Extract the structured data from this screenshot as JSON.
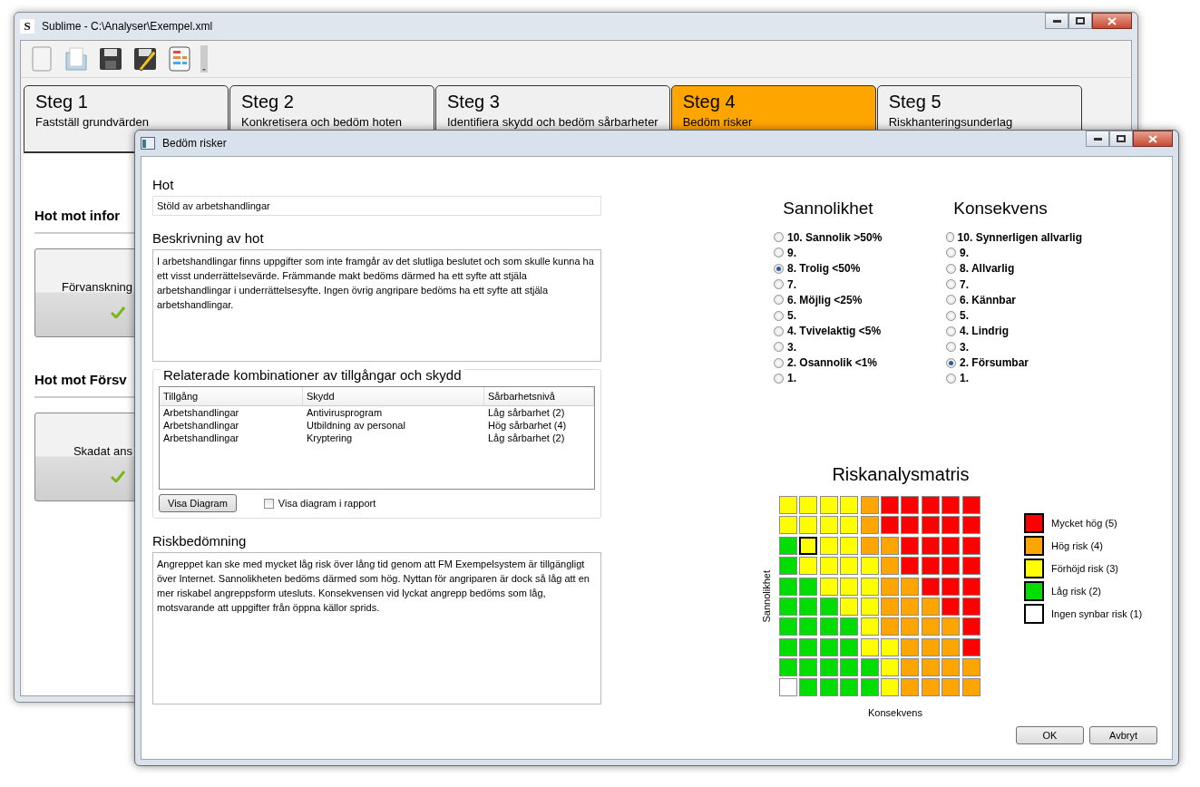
{
  "main_window": {
    "app_icon": "S",
    "title": "Sublime - C:\\Analyser\\Exempel.xml",
    "tabs": [
      {
        "step": "Steg 1",
        "label": "Fastställ grundvärden",
        "selected": false
      },
      {
        "step": "Steg 2",
        "label": "Konkretisera och bedöm hoten",
        "selected": false
      },
      {
        "step": "Steg 3",
        "label": "Identifiera skydd och bedöm sårbarheter",
        "selected": false
      },
      {
        "step": "Steg 4",
        "label": "Bedöm risker",
        "selected": true
      },
      {
        "step": "Steg 5",
        "label": "Riskhanteringsunderlag",
        "selected": false
      }
    ],
    "sections": [
      {
        "heading": "Hot mot infor",
        "cards": [
          {
            "label": "Förvanskning",
            "done": true
          }
        ]
      },
      {
        "heading": "Hot mot Försv",
        "cards": [
          {
            "label": "Skadat ans",
            "done": true
          }
        ]
      }
    ]
  },
  "dialog": {
    "title": "Bedöm risker",
    "threat_label": "Hot",
    "threat": "Stöld av arbetshandlingar",
    "description_label": "Beskrivning av hot",
    "description": "I arbetshandlingar finns uppgifter som inte framgår av det slutliga beslutet och som skulle kunna ha ett visst underrättelsevärde. Främmande makt bedöms därmed ha ett syfte att stjäla arbetshandlingar i underrättelsesyfte. Ingen övrig angripare bedöms ha ett syfte att stjäla arbetshandlingar.",
    "related": {
      "legend": "Relaterade kombinationer av tillgångar och skydd",
      "columns": [
        "Tillgång",
        "Skydd",
        "Sårbarhetsnivå"
      ],
      "rows": [
        [
          "Arbetshandlingar",
          "Antivirusprogram",
          "Låg sårbarhet (2)"
        ],
        [
          "Arbetshandlingar",
          "Utbildning av personal",
          "Hög sårbarhet (4)"
        ],
        [
          "Arbetshandlingar",
          "Kryptering",
          "Låg sårbarhet (2)"
        ]
      ],
      "diagram_button": "Visa Diagram",
      "report_checkbox": {
        "label": "Visa diagram i rapport",
        "checked": false
      }
    },
    "assessment_label": "Riskbedömning",
    "assessment": "Angreppet kan ske med mycket låg risk över lång tid genom att FM Exempelsystem är tillgängligt över Internet. Sannolikheten bedöms därmed som hög. Nyttan för angriparen är dock så låg att en mer riskabel angreppsform utesluts. Konsekvensen vid lyckat angrepp bedöms som låg, motsvarande att uppgifter från öppna källor sprids.",
    "likelihood": {
      "heading": "Sannolikhet",
      "options": [
        {
          "label": "10. Sannolik >50%",
          "selected": false
        },
        {
          "label": "9.",
          "selected": false
        },
        {
          "label": "8. Trolig <50%",
          "selected": true
        },
        {
          "label": "7.",
          "selected": false
        },
        {
          "label": "6. Möjlig <25%",
          "selected": false
        },
        {
          "label": "5.",
          "selected": false
        },
        {
          "label": "4. Tvivelaktig <5%",
          "selected": false
        },
        {
          "label": "3.",
          "selected": false
        },
        {
          "label": "2. Osannolik <1%",
          "selected": false
        },
        {
          "label": "1.",
          "selected": false
        }
      ]
    },
    "consequence": {
      "heading": "Konsekvens",
      "options": [
        {
          "label": "10. Synnerligen allvarlig",
          "selected": false
        },
        {
          "label": "9.",
          "selected": false
        },
        {
          "label": "8. Allvarlig",
          "selected": false
        },
        {
          "label": "7.",
          "selected": false
        },
        {
          "label": "6. Kännbar",
          "selected": false
        },
        {
          "label": "5.",
          "selected": false
        },
        {
          "label": "4. Lindrig",
          "selected": false
        },
        {
          "label": "3.",
          "selected": false
        },
        {
          "label": "2. Försumbar",
          "selected": true
        },
        {
          "label": "1.",
          "selected": false
        }
      ]
    },
    "matrix": {
      "title": "Riskanalysmatris",
      "ylabel": "Sannolikhet",
      "xlabel": "Konsekvens",
      "rows": [
        [
          {
            "color": "#ffff00",
            "selected": false
          },
          {
            "color": "#ffff00",
            "selected": false
          },
          {
            "color": "#ffff00",
            "selected": false
          },
          {
            "color": "#ffff00",
            "selected": false
          },
          {
            "color": "#ffa500",
            "selected": false
          },
          {
            "color": "#ff0000",
            "selected": false
          },
          {
            "color": "#ff0000",
            "selected": false
          },
          {
            "color": "#ff0000",
            "selected": false
          },
          {
            "color": "#ff0000",
            "selected": false
          },
          {
            "color": "#ff0000",
            "selected": false
          }
        ],
        [
          {
            "color": "#ffff00",
            "selected": false
          },
          {
            "color": "#ffff00",
            "selected": false
          },
          {
            "color": "#ffff00",
            "selected": false
          },
          {
            "color": "#ffff00",
            "selected": false
          },
          {
            "color": "#ffa500",
            "selected": false
          },
          {
            "color": "#ff0000",
            "selected": false
          },
          {
            "color": "#ff0000",
            "selected": false
          },
          {
            "color": "#ff0000",
            "selected": false
          },
          {
            "color": "#ff0000",
            "selected": false
          },
          {
            "color": "#ff0000",
            "selected": false
          }
        ],
        [
          {
            "color": "#00dd00",
            "selected": false
          },
          {
            "color": "#ffff00",
            "selected": true
          },
          {
            "color": "#ffff00",
            "selected": false
          },
          {
            "color": "#ffff00",
            "selected": false
          },
          {
            "color": "#ffa500",
            "selected": false
          },
          {
            "color": "#ffa500",
            "selected": false
          },
          {
            "color": "#ff0000",
            "selected": false
          },
          {
            "color": "#ff0000",
            "selected": false
          },
          {
            "color": "#ff0000",
            "selected": false
          },
          {
            "color": "#ff0000",
            "selected": false
          }
        ],
        [
          {
            "color": "#00dd00",
            "selected": false
          },
          {
            "color": "#ffff00",
            "selected": false
          },
          {
            "color": "#ffff00",
            "selected": false
          },
          {
            "color": "#ffff00",
            "selected": false
          },
          {
            "color": "#ffff00",
            "selected": false
          },
          {
            "color": "#ffa500",
            "selected": false
          },
          {
            "color": "#ff0000",
            "selected": false
          },
          {
            "color": "#ff0000",
            "selected": false
          },
          {
            "color": "#ff0000",
            "selected": false
          },
          {
            "color": "#ff0000",
            "selected": false
          }
        ],
        [
          {
            "color": "#00dd00",
            "selected": false
          },
          {
            "color": "#00dd00",
            "selected": false
          },
          {
            "color": "#ffff00",
            "selected": false
          },
          {
            "color": "#ffff00",
            "selected": false
          },
          {
            "color": "#ffff00",
            "selected": false
          },
          {
            "color": "#ffa500",
            "selected": false
          },
          {
            "color": "#ffa500",
            "selected": false
          },
          {
            "color": "#ff0000",
            "selected": false
          },
          {
            "color": "#ff0000",
            "selected": false
          },
          {
            "color": "#ff0000",
            "selected": false
          }
        ],
        [
          {
            "color": "#00dd00",
            "selected": false
          },
          {
            "color": "#00dd00",
            "selected": false
          },
          {
            "color": "#00dd00",
            "selected": false
          },
          {
            "color": "#ffff00",
            "selected": false
          },
          {
            "color": "#ffff00",
            "selected": false
          },
          {
            "color": "#ffa500",
            "selected": false
          },
          {
            "color": "#ffa500",
            "selected": false
          },
          {
            "color": "#ffa500",
            "selected": false
          },
          {
            "color": "#ff0000",
            "selected": false
          },
          {
            "color": "#ff0000",
            "selected": false
          }
        ],
        [
          {
            "color": "#00dd00",
            "selected": false
          },
          {
            "color": "#00dd00",
            "selected": false
          },
          {
            "color": "#00dd00",
            "selected": false
          },
          {
            "color": "#00dd00",
            "selected": false
          },
          {
            "color": "#ffff00",
            "selected": false
          },
          {
            "color": "#ffa500",
            "selected": false
          },
          {
            "color": "#ffa500",
            "selected": false
          },
          {
            "color": "#ffa500",
            "selected": false
          },
          {
            "color": "#ffa500",
            "selected": false
          },
          {
            "color": "#ff0000",
            "selected": false
          }
        ],
        [
          {
            "color": "#00dd00",
            "selected": false
          },
          {
            "color": "#00dd00",
            "selected": false
          },
          {
            "color": "#00dd00",
            "selected": false
          },
          {
            "color": "#00dd00",
            "selected": false
          },
          {
            "color": "#ffff00",
            "selected": false
          },
          {
            "color": "#ffff00",
            "selected": false
          },
          {
            "color": "#ffa500",
            "selected": false
          },
          {
            "color": "#ffa500",
            "selected": false
          },
          {
            "color": "#ffa500",
            "selected": false
          },
          {
            "color": "#ff0000",
            "selected": false
          }
        ],
        [
          {
            "color": "#00dd00",
            "selected": false
          },
          {
            "color": "#00dd00",
            "selected": false
          },
          {
            "color": "#00dd00",
            "selected": false
          },
          {
            "color": "#00dd00",
            "selected": false
          },
          {
            "color": "#00dd00",
            "selected": false
          },
          {
            "color": "#ffff00",
            "selected": false
          },
          {
            "color": "#ffa500",
            "selected": false
          },
          {
            "color": "#ffa500",
            "selected": false
          },
          {
            "color": "#ffa500",
            "selected": false
          },
          {
            "color": "#ffa500",
            "selected": false
          }
        ],
        [
          {
            "color": "#ffffff",
            "selected": false
          },
          {
            "color": "#00dd00",
            "selected": false
          },
          {
            "color": "#00dd00",
            "selected": false
          },
          {
            "color": "#00dd00",
            "selected": false
          },
          {
            "color": "#00dd00",
            "selected": false
          },
          {
            "color": "#ffff00",
            "selected": false
          },
          {
            "color": "#ffa500",
            "selected": false
          },
          {
            "color": "#ffa500",
            "selected": false
          },
          {
            "color": "#ffa500",
            "selected": false
          },
          {
            "color": "#ffa500",
            "selected": false
          }
        ]
      ]
    },
    "legend": [
      {
        "label": "Mycket hög (5)",
        "color": "#ff0000"
      },
      {
        "label": "Hög risk (4)",
        "color": "#ffa500"
      },
      {
        "label": "Förhöjd risk (3)",
        "color": "#ffff00"
      },
      {
        "label": "Låg risk (2)",
        "color": "#00dd00"
      },
      {
        "label": "Ingen synbar risk (1)",
        "color": "#ffffff"
      }
    ],
    "buttons": [
      "OK",
      "Avbryt"
    ]
  }
}
